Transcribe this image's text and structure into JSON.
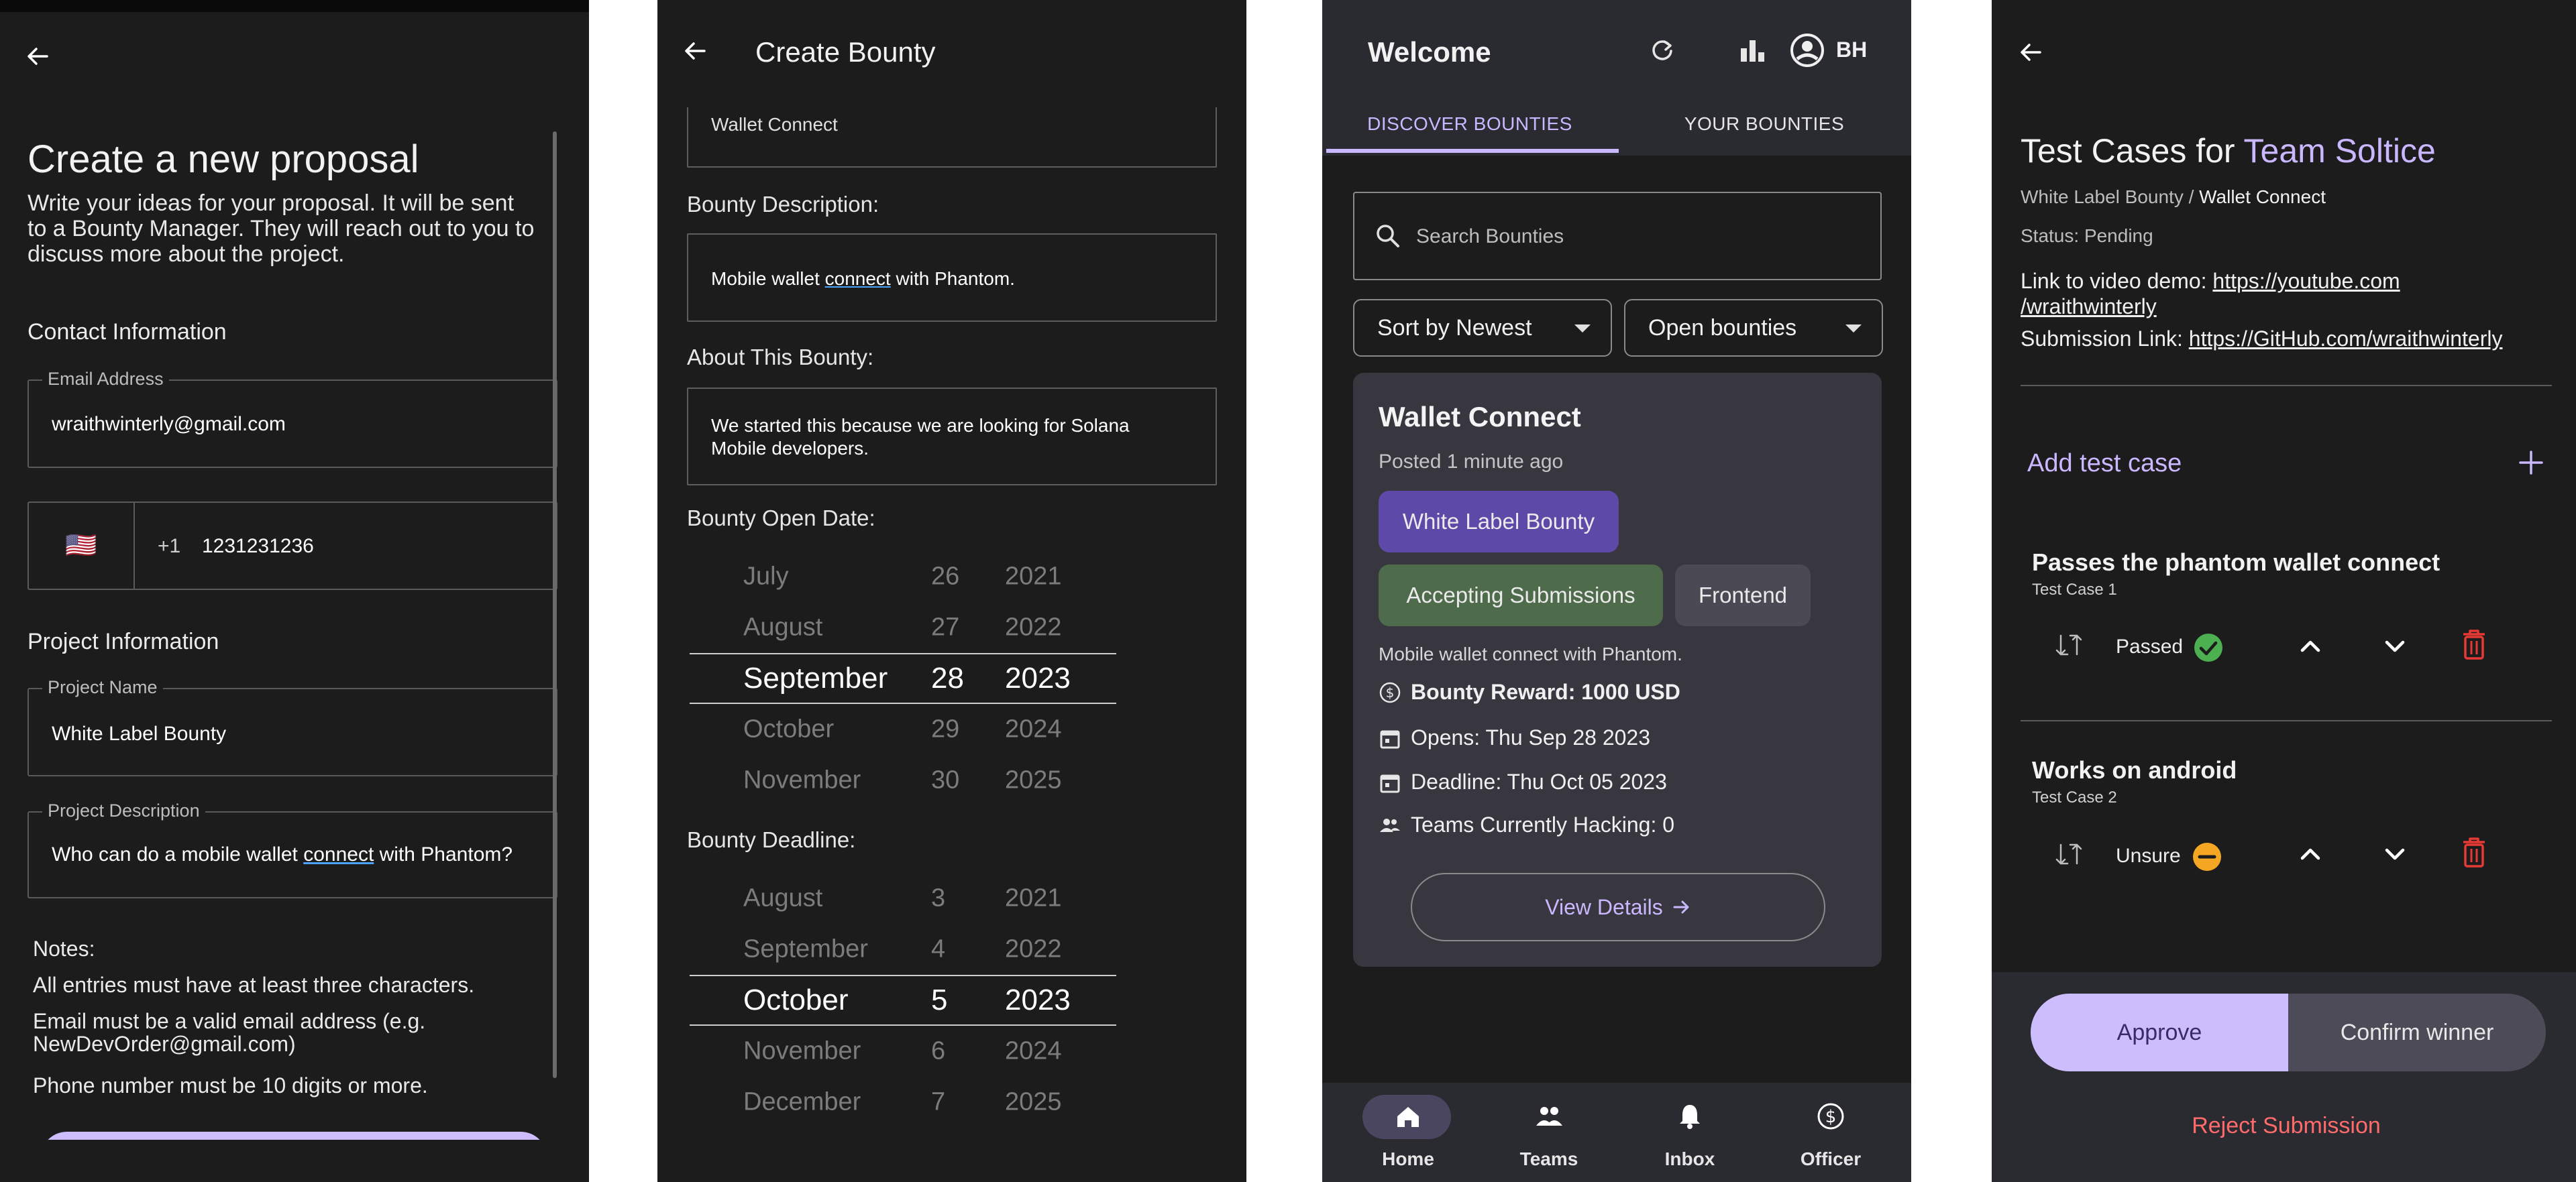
{
  "screen1": {
    "title": "Create a new proposal",
    "intro_line1": "Write your ideas for your proposal. It will be sent",
    "intro_line2": "to a Bounty Manager. They will reach out to you to",
    "intro_line3": "discuss more about the project.",
    "contact_heading": "Contact Information",
    "email_label": "Email Address",
    "email_value": "wraithwinterly@gmail.com",
    "flag": "🇺🇸",
    "phone_code": "+1",
    "phone_value": "1231231236",
    "project_heading": "Project Information",
    "project_name_label": "Project Name",
    "project_name_value": "White Label Bounty",
    "project_desc_label": "Project Description",
    "project_desc_before": "Who can do a mobile wallet ",
    "project_desc_link": "connect",
    "project_desc_after": " with Phantom?",
    "notes_heading": "Notes:",
    "note1": "All entries must have at least three characters.",
    "note2_line1": "Email must be a valid email address (e.g.",
    "note2_line2": "NewDevOrder@gmail.com)",
    "note3": "Phone number must be 10 digits or more."
  },
  "screen2": {
    "title": "Create Bounty",
    "partial_field": "Wallet Connect",
    "desc_label": "Bounty Description:",
    "desc_before": "Mobile wallet ",
    "desc_link": "connect",
    "desc_after": " with Phantom.",
    "about_label": "About This Bounty:",
    "about_line1": "We started this because we are looking for Solana",
    "about_line2": "Mobile developers.",
    "open_label": "Bounty Open Date:",
    "open_picker": [
      [
        "July",
        "26",
        "2021"
      ],
      [
        "August",
        "27",
        "2022"
      ],
      [
        "September",
        "28",
        "2023"
      ],
      [
        "October",
        "29",
        "2024"
      ],
      [
        "November",
        "30",
        "2025"
      ]
    ],
    "deadline_label": "Bounty Deadline:",
    "deadline_picker": [
      [
        "August",
        "3",
        "2021"
      ],
      [
        "September",
        "4",
        "2022"
      ],
      [
        "October",
        "5",
        "2023"
      ],
      [
        "November",
        "6",
        "2024"
      ],
      [
        "December",
        "7",
        "2025"
      ]
    ]
  },
  "screen3": {
    "title": "Welcome",
    "avatar_initials": "BH",
    "tab_discover": "DISCOVER BOUNTIES",
    "tab_yours": "YOUR BOUNTIES",
    "search_placeholder": "Search Bounties",
    "sort_value": "Sort by Newest",
    "filter_value": "Open bounties",
    "card_title": "Wallet Connect",
    "posted": "Posted 1 minute ago",
    "chip1": "White Label Bounty",
    "chip2": "Accepting Submissions",
    "chip3": "Frontend",
    "card_desc": "Mobile wallet connect with Phantom.",
    "reward": "Bounty Reward: 1000 USD",
    "opens": "Opens: Thu Sep 28 2023",
    "deadline": "Deadline: Thu Oct 05 2023",
    "teams": "Teams Currently Hacking: 0",
    "view_details": "View Details",
    "nav": [
      "Home",
      "Teams",
      "Inbox",
      "Officer"
    ],
    "colors": {
      "accent": "#c9b8ff",
      "chip_purple": "#5d4aa8",
      "chip_green": "#4e6b4c",
      "chip_gray": "#4a4954",
      "card_bg": "#38373f"
    }
  },
  "screen4": {
    "title_prefix": "Test Cases for ",
    "title_team": "Team Soltice",
    "crumb_parent": "White Label Bounty /",
    "crumb_current": "Wallet Connect",
    "status": "Status: Pending",
    "video_label": "Link to video demo: ",
    "video_link_line1": "https://youtube.com",
    "video_link_line2": "/wraithwinterly",
    "submission_label": "Submission Link: ",
    "submission_link": "https://GitHub.com/wraithwinterly",
    "add_test_case": "Add test case",
    "test_cases": [
      {
        "title": "Passes the phantom wallet connect",
        "sub": "Test Case 1",
        "status": "Passed"
      },
      {
        "title": "Works on android",
        "sub": "Test Case 2",
        "status": "Unsure"
      }
    ],
    "approve": "Approve",
    "confirm_winner": "Confirm winner",
    "reject": "Reject Submission",
    "colors": {
      "passed": "#4caf50",
      "unsure": "#f5a623",
      "delete": "#e53935",
      "reject": "#ff6b6b"
    }
  }
}
